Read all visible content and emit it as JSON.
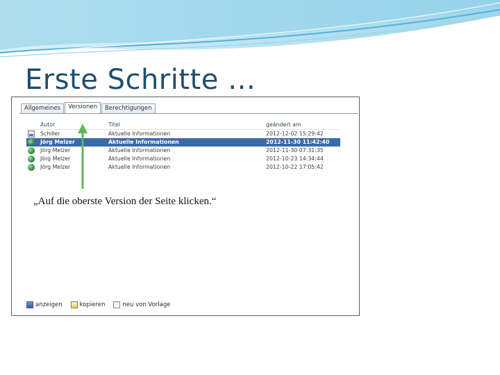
{
  "slide": {
    "title": "Erste Schritte …",
    "callout": "„Auf die oberste Version der Seite klicken.“"
  },
  "tabs": [
    {
      "label": "Allgemeines",
      "active": false
    },
    {
      "label": "Versionen",
      "active": true
    },
    {
      "label": "Berechtigungen",
      "active": false
    }
  ],
  "table": {
    "headers": {
      "autor": "Autor",
      "titel": "Titel",
      "date": "geändert am"
    },
    "rows": [
      {
        "icon": "page-icon",
        "autor": "Schiller",
        "titel": "Aktuelle Informationen",
        "date": "2012-12-02 15:29:42",
        "selected": false
      },
      {
        "icon": "globe-icon",
        "autor": "Jörg Melzer",
        "titel": "Aktuelle Informationen",
        "date": "2012-11-30 11:42:40",
        "selected": true
      },
      {
        "icon": "globe-icon",
        "autor": "Jörg Melzer",
        "titel": "Aktuelle Informationen",
        "date": "2012-11-30 07:31:35",
        "selected": false
      },
      {
        "icon": "globe-icon",
        "autor": "Jörg Melzer",
        "titel": "Aktuelle Informationen",
        "date": "2012-10-23 14:34:44",
        "selected": false
      },
      {
        "icon": "globe-icon",
        "autor": "Jörg Melzer",
        "titel": "Aktuelle Informationen",
        "date": "2012-10-22 17:05:42",
        "selected": false
      }
    ]
  },
  "toolbar": {
    "view_label": "anzeigen",
    "copy_label": "kopieren",
    "new_label": "neu von Vorlage"
  },
  "colors": {
    "title": "#1f4e6e",
    "wave": "#4fb3d9",
    "selection": "#3c6aa8",
    "arrow": "#5cb85c"
  }
}
